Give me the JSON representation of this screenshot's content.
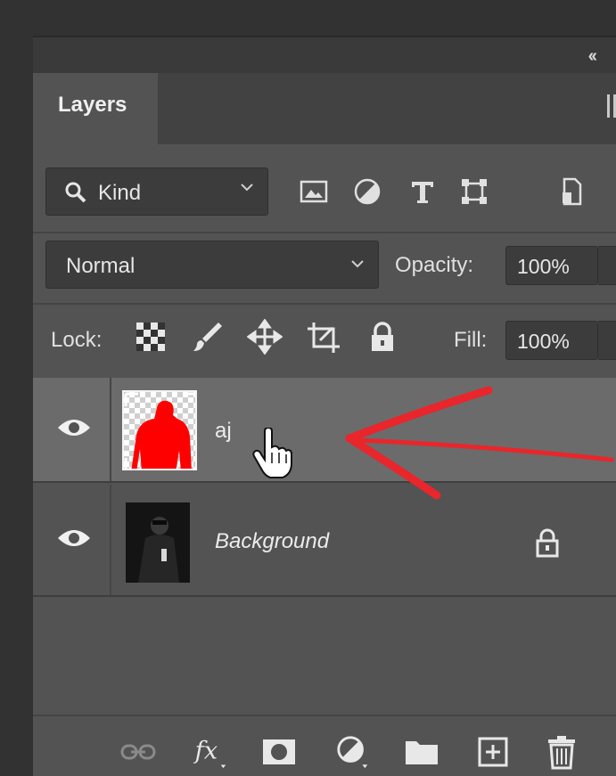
{
  "panel": {
    "tab_label": "Layers",
    "collapse_icon": "double-chevron-left-icon"
  },
  "filter": {
    "kind_label": "Kind",
    "icons": [
      "image-filter-icon",
      "adjustment-filter-icon",
      "type-filter-icon",
      "shape-filter-icon",
      "smart-object-filter-icon"
    ]
  },
  "blend": {
    "mode": "Normal",
    "opacity_label": "Opacity:",
    "opacity_value": "100%"
  },
  "lock": {
    "label": "Lock:",
    "fill_label": "Fill:",
    "fill_value": "100%"
  },
  "layers": [
    {
      "name": "aj",
      "visible": true,
      "selected": true,
      "locked": false
    },
    {
      "name": "Background",
      "visible": true,
      "selected": false,
      "locked": true
    }
  ],
  "colors": {
    "panel_bg": "#535353",
    "selected_layer": "#6b6b6b",
    "annotation_arrow": "#e8262b",
    "silhouette": "#ff0000"
  }
}
